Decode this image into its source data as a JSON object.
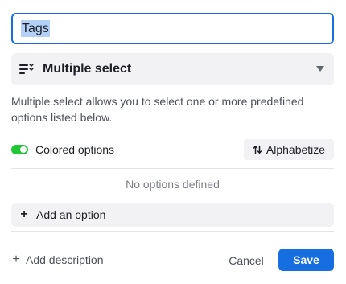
{
  "field": {
    "name_value": "Tags",
    "type_label": "Multiple select",
    "type_icon": "multiple-select-icon",
    "type_description": "Multiple select allows you to select one or more predefined options listed below."
  },
  "options": {
    "colored_label": "Colored options",
    "colored_enabled": true,
    "alphabetize_label": "Alphabetize",
    "empty_text": "No options defined",
    "add_option_label": "Add an option"
  },
  "footer": {
    "add_description_label": "Add description",
    "cancel_label": "Cancel",
    "save_label": "Save"
  },
  "colors": {
    "accent": "#166ee1",
    "toggle_on": "#20c933",
    "surface": "#f2f2f4",
    "selection": "#b3d1f7"
  }
}
